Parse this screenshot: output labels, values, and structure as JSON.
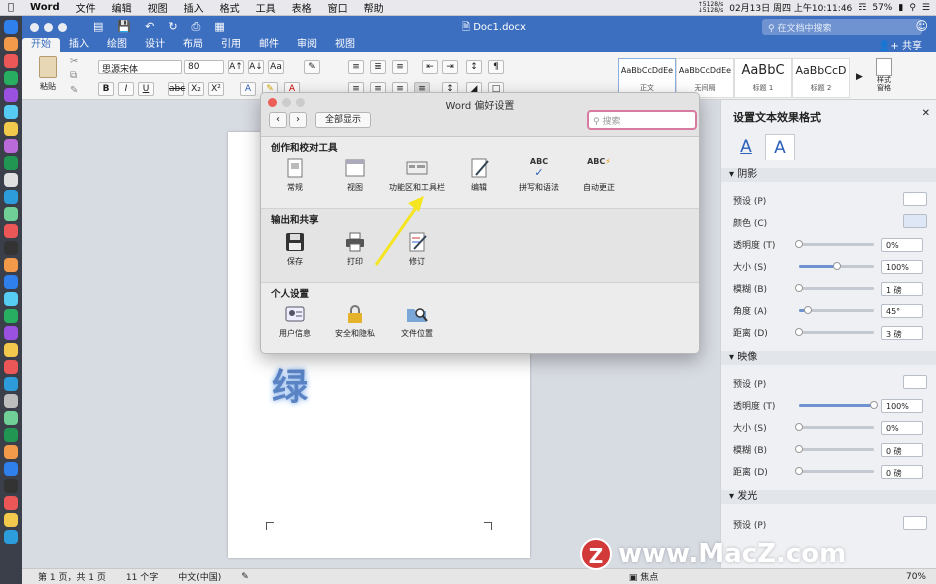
{
  "menubar": {
    "app": "Word",
    "items": [
      "文件",
      "编辑",
      "视图",
      "插入",
      "格式",
      "工具",
      "表格",
      "窗口",
      "帮助"
    ],
    "status_net": "↑5128/s\n↓5128/s",
    "clock": "02月13日 周四 上午10:11:46",
    "battery": "57%"
  },
  "titlebar": {
    "document": "Doc1.docx",
    "search_placeholder": "在文档中搜索"
  },
  "ribbon": {
    "tabs": [
      "开始",
      "插入",
      "绘图",
      "设计",
      "布局",
      "引用",
      "邮件",
      "审阅",
      "视图"
    ],
    "active_tab": "开始",
    "share": "共享",
    "paste": "粘贴",
    "font_name": "思源宋体",
    "font_size": "80",
    "styles": [
      {
        "preview": "AaBbCcDdEe",
        "name": "正文"
      },
      {
        "preview": "AaBbCcDdEe",
        "name": "无间隔"
      },
      {
        "preview": "AaBbC",
        "name": "标题 1"
      },
      {
        "preview": "AaBbCcD",
        "name": "标题 2"
      }
    ],
    "style_pane": "样式\n窗格"
  },
  "document": {
    "text": "绿"
  },
  "dialog": {
    "title": "Word 偏好设置",
    "show_all": "全部显示",
    "search_placeholder": "搜索",
    "groups": [
      {
        "title": "创作和校对工具",
        "items": [
          "常规",
          "视图",
          "功能区和工具栏",
          "编辑",
          "拼写和语法",
          "自动更正"
        ]
      },
      {
        "title": "输出和共享",
        "items": [
          "保存",
          "打印",
          "修订"
        ]
      },
      {
        "title": "个人设置",
        "items": [
          "用户信息",
          "安全和隐私",
          "文件位置"
        ]
      }
    ],
    "abc": "ABC"
  },
  "pane": {
    "title": "设置文本效果格式",
    "sections": {
      "shadow": "阴影",
      "reflection": "映像",
      "glow": "发光"
    },
    "shadow": {
      "preset": "预设 (P)",
      "color": "颜色 (C)",
      "rows": [
        {
          "label": "透明度 (T)",
          "value": "0%",
          "level": 0
        },
        {
          "label": "大小 (S)",
          "value": "100%",
          "level": 0.5
        },
        {
          "label": "模糊 (B)",
          "value": "1 磅",
          "level": 0
        },
        {
          "label": "角度 (A)",
          "value": "45°",
          "level": 0.12
        },
        {
          "label": "距离 (D)",
          "value": "3 磅",
          "level": 0
        }
      ]
    },
    "reflection": {
      "preset": "预设 (P)",
      "rows": [
        {
          "label": "透明度 (T)",
          "value": "100%",
          "level": 1
        },
        {
          "label": "大小 (S)",
          "value": "0%",
          "level": 0
        },
        {
          "label": "模糊 (B)",
          "value": "0 磅",
          "level": 0
        },
        {
          "label": "距离 (D)",
          "value": "0 磅",
          "level": 0
        }
      ]
    },
    "glow": {
      "preset": "预设 (P)"
    }
  },
  "statusbar": {
    "page": "第 1 页，共 1 页",
    "words": "11 个字",
    "lang": "中文(中国)",
    "focus": "焦点",
    "zoom": "70%"
  },
  "watermark": {
    "logo": "Z",
    "text": "www.MacZ.com"
  }
}
